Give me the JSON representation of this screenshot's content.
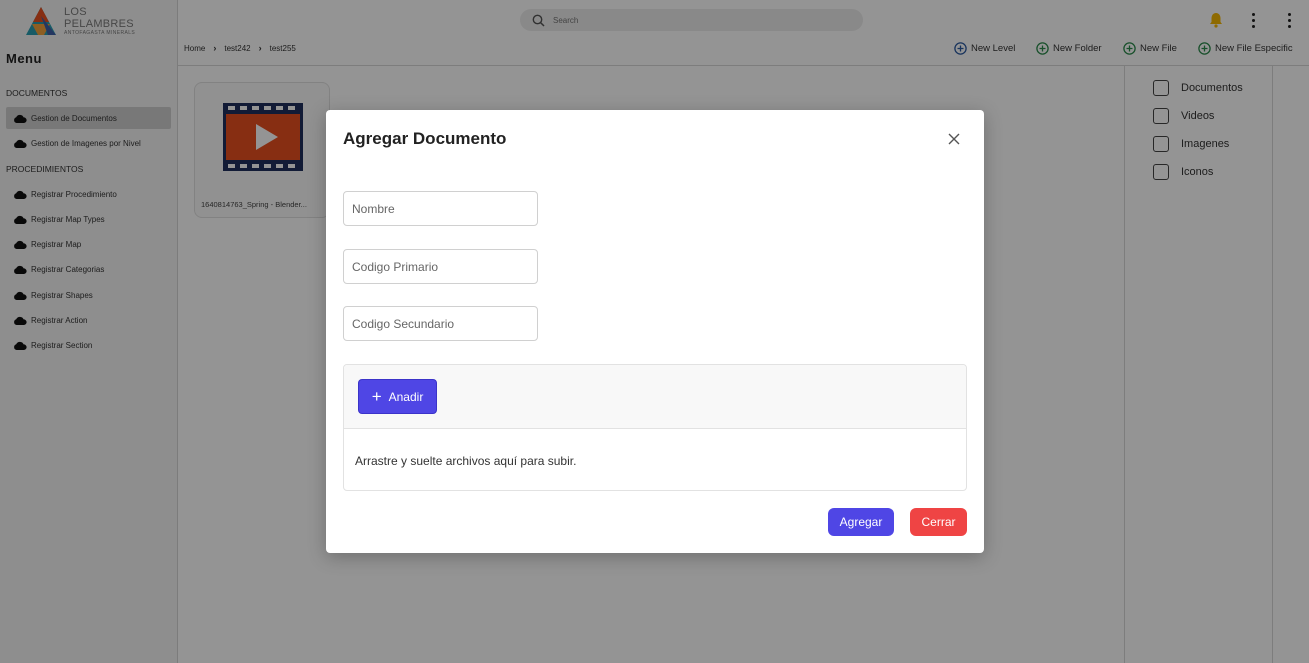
{
  "brand": {
    "title": "LOS PELAMBRES",
    "subtitle": "ANTOFAGASTA MINERALS"
  },
  "sidebar": {
    "menu_title": "Menu",
    "sections": [
      {
        "label": "DOCUMENTOS",
        "items": [
          {
            "label": "Gestion de Documentos",
            "active": true
          },
          {
            "label": "Gestion de Imagenes por Nivel",
            "active": false
          }
        ]
      },
      {
        "label": "PROCEDIMIENTOS",
        "items": [
          {
            "label": "Registrar Procedimiento"
          },
          {
            "label": "Registrar Map Types"
          },
          {
            "label": "Registrar Map"
          },
          {
            "label": "Registrar Categorias"
          },
          {
            "label": "Registrar Shapes"
          },
          {
            "label": "Registrar Action"
          },
          {
            "label": "Registrar Section"
          }
        ]
      }
    ]
  },
  "search": {
    "placeholder": "Search"
  },
  "breadcrumb": [
    "Home",
    "test242",
    "test255"
  ],
  "toolbar": {
    "new_level": "New Level",
    "new_folder": "New Folder",
    "new_file": "New File",
    "new_file_especific": "New File Especific"
  },
  "filters": [
    "Documentos",
    "Videos",
    "Imagenes",
    "Iconos"
  ],
  "files": [
    {
      "name": "1640814763_Spring - Blender..."
    }
  ],
  "modal": {
    "title": "Agregar Documento",
    "fields": {
      "nombre": "Nombre",
      "codigo_primario": "Codigo Primario",
      "codigo_secundario": "Codigo Secundario"
    },
    "add_button": "Anadir",
    "drop_hint": "Arrastre y suelte archivos aquí para subir.",
    "submit": "Agregar",
    "close": "Cerrar"
  },
  "colors": {
    "primary": "#4f46e5",
    "danger": "#ef4444",
    "video_orange": "#e8501f",
    "video_navy": "#1f2f5e",
    "add_green": "#2a8a4a",
    "add_blue": "#2c5aa0",
    "bell": "#f5b700"
  }
}
